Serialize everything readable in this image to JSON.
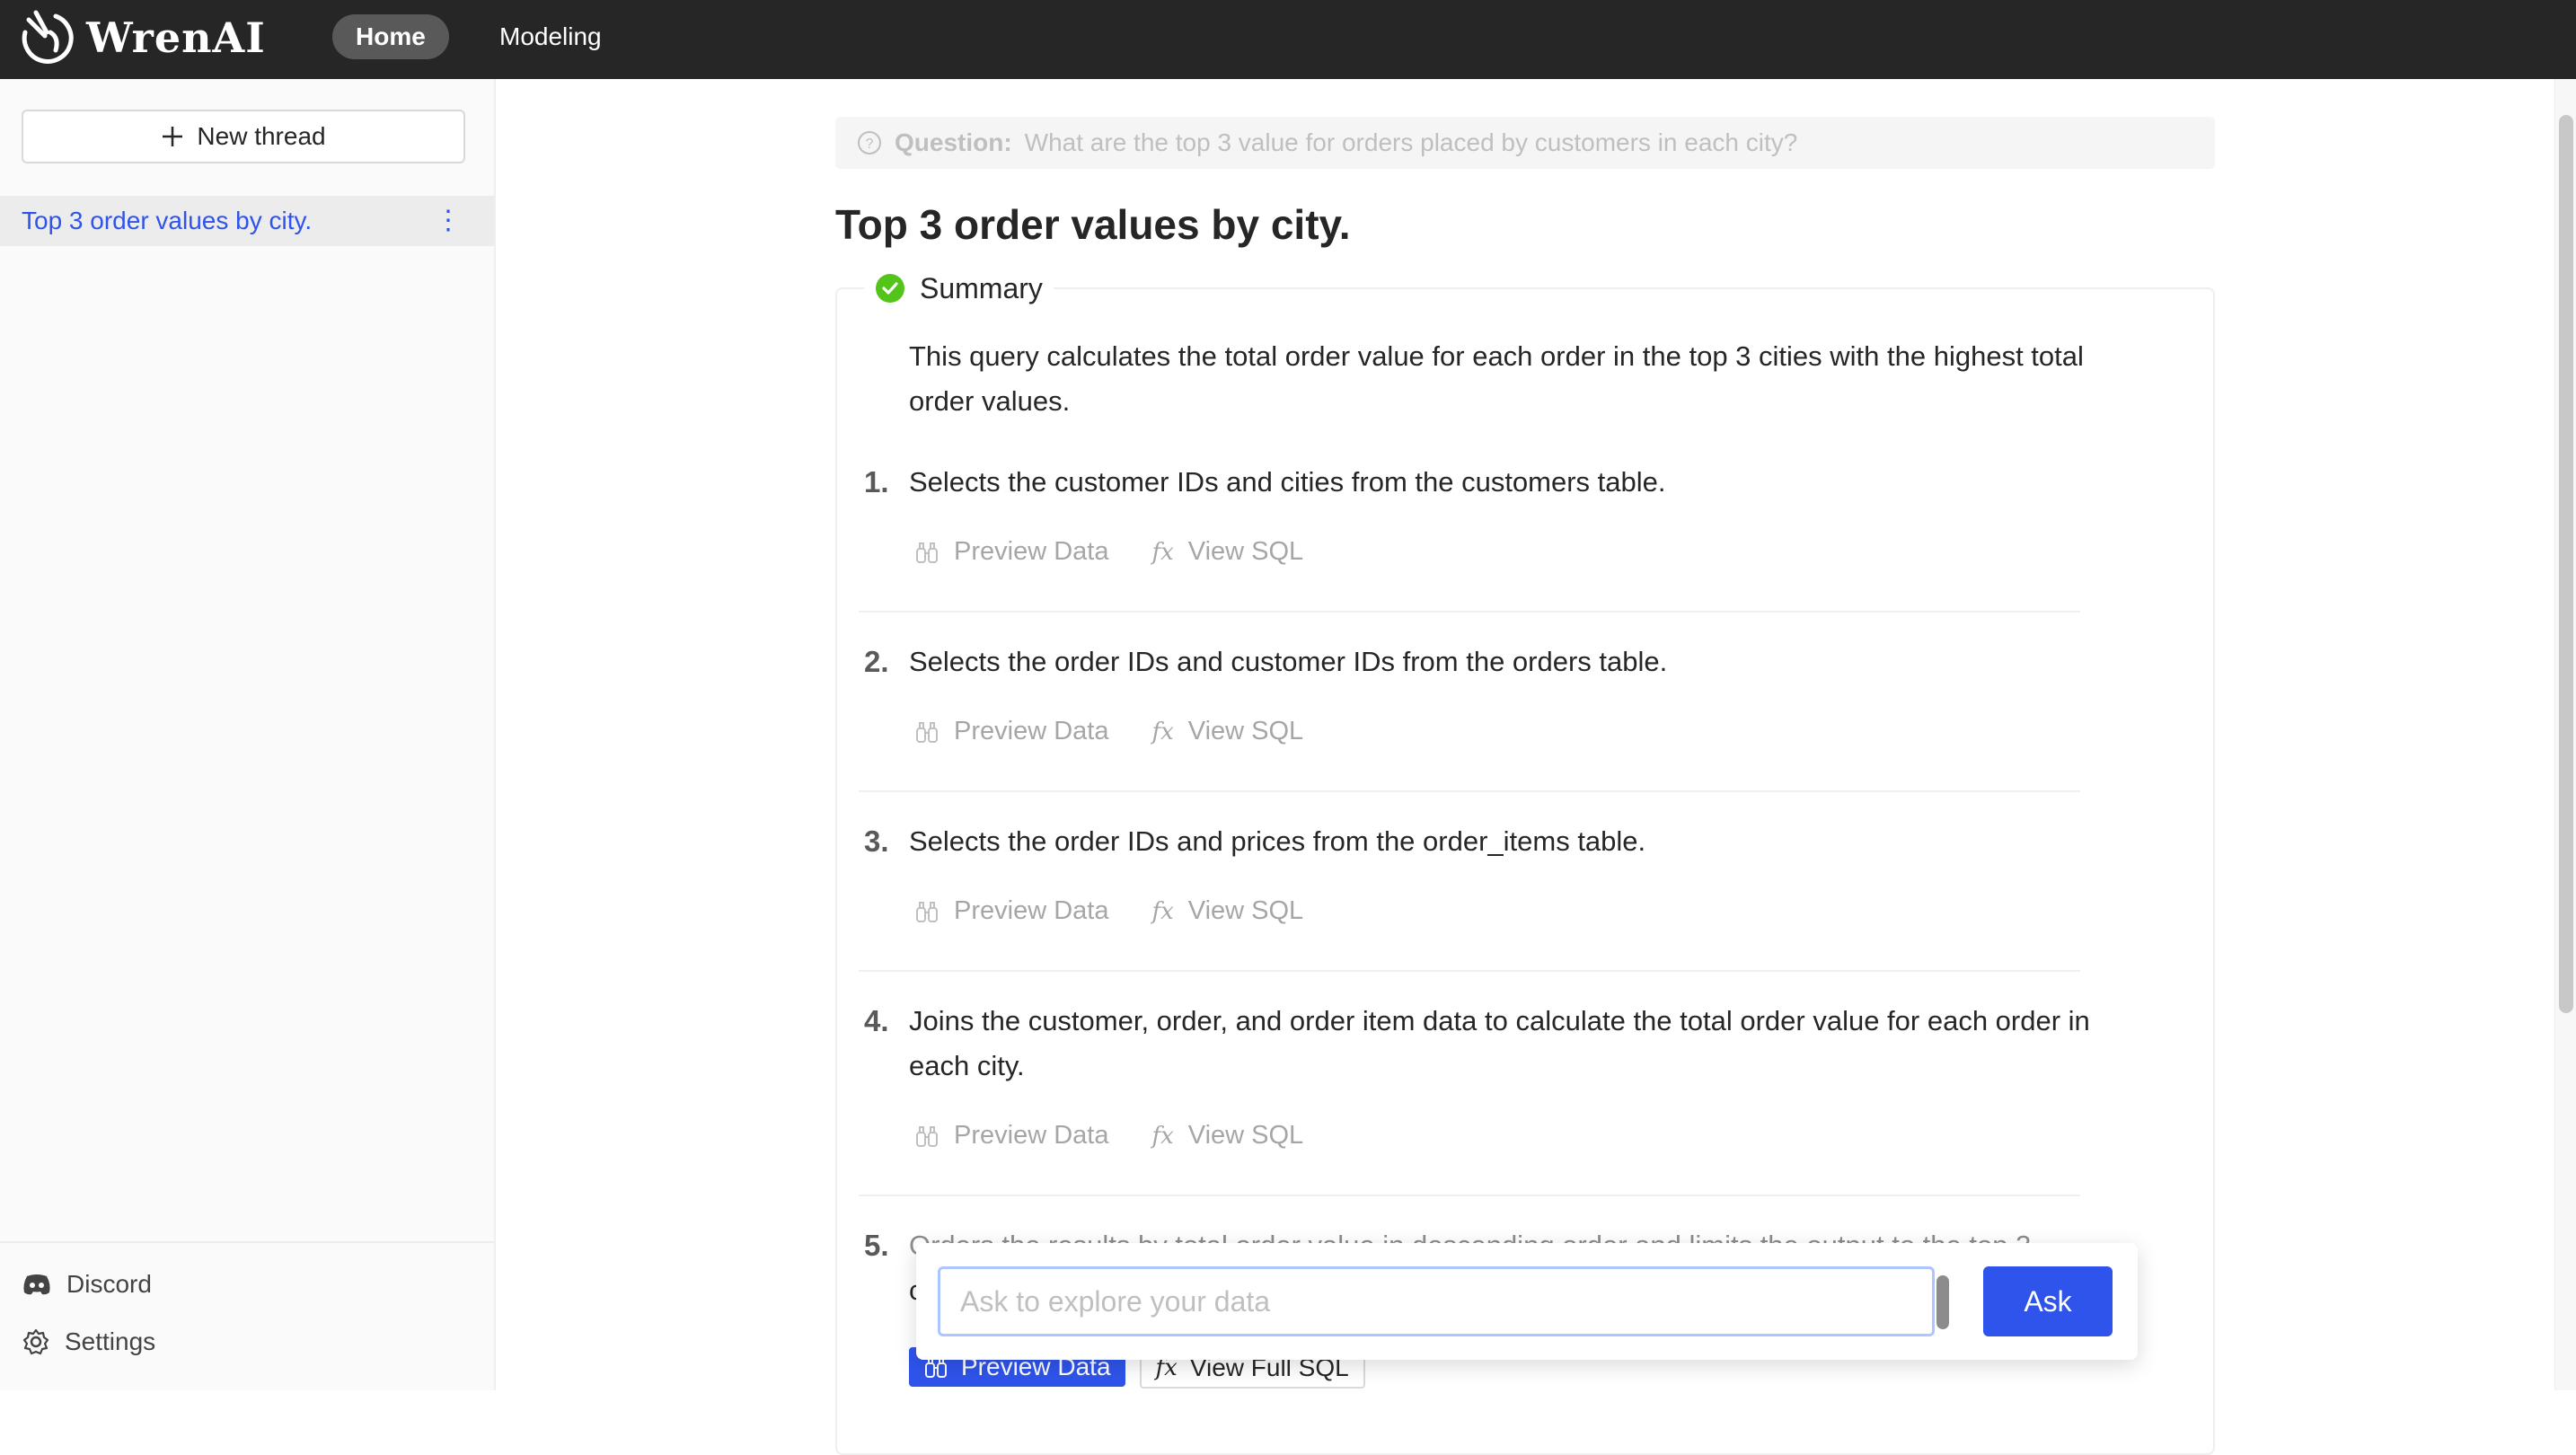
{
  "app": {
    "brand": "WrenAI"
  },
  "nav": {
    "home": "Home",
    "modeling": "Modeling"
  },
  "sidebar": {
    "new_thread": "New thread",
    "threads": [
      {
        "label": "Top 3 order values by city."
      }
    ],
    "footer": {
      "discord": "Discord",
      "settings": "Settings"
    }
  },
  "main": {
    "question_label": "Question:",
    "question": "What are the top 3 value for orders placed by customers in each city?",
    "title": "Top 3 order values by city.",
    "summary_label": "Summary",
    "summary_text": "This query calculates the total order value for each order in the top 3 cities with the highest total order values.",
    "steps": [
      {
        "num": "1.",
        "text": "Selects the customer IDs and cities from the customers table.",
        "preview": "Preview Data",
        "sql": "View SQL"
      },
      {
        "num": "2.",
        "text": "Selects the order IDs and customer IDs from the orders table.",
        "preview": "Preview Data",
        "sql": "View SQL"
      },
      {
        "num": "3.",
        "text": "Selects the order IDs and prices from the order_items table.",
        "preview": "Preview Data",
        "sql": "View SQL"
      },
      {
        "num": "4.",
        "text": "Joins the customer, order, and order item data to calculate the total order value for each order in each city.",
        "preview": "Preview Data",
        "sql": "View SQL"
      },
      {
        "num": "5.",
        "text": "Orders the results by total order value in descending order and limits the output to the top 3",
        "text2": "c"
      }
    ],
    "bottom_preview": "Preview Data",
    "bottom_full_sql": "View Full SQL"
  },
  "ask": {
    "placeholder": "Ask to explore your data",
    "button": "Ask"
  },
  "colors": {
    "primary": "#2f54eb",
    "topbar": "#262626",
    "success": "#52c41a"
  }
}
